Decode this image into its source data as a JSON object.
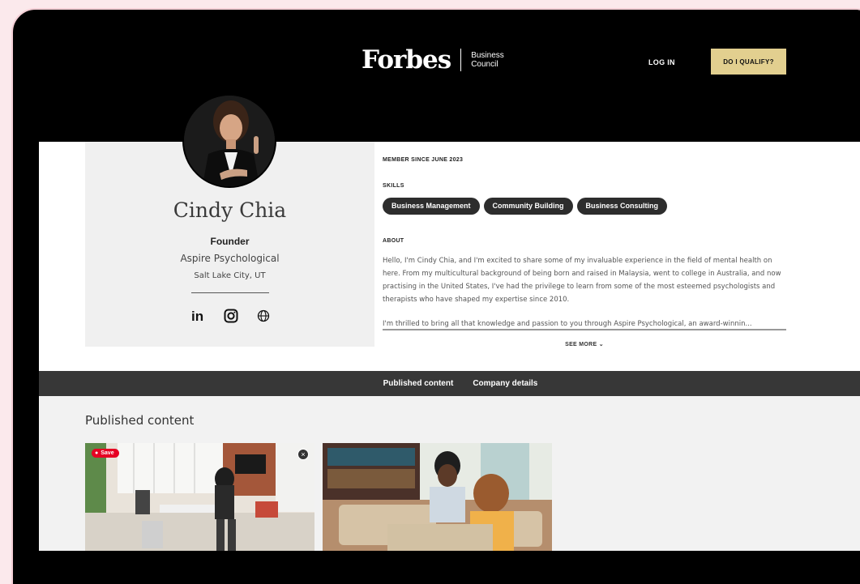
{
  "header": {
    "logo_main": "Forbes",
    "logo_sub_line1": "Business",
    "logo_sub_line2": "Council",
    "login_label": "LOG IN",
    "qualify_label": "DO I QUALIFY?"
  },
  "profile": {
    "name": "Cindy Chia",
    "role": "Founder",
    "company": "Aspire Psychological",
    "location": "Salt Lake City, UT",
    "socials": [
      "linkedin-icon",
      "instagram-icon",
      "globe-icon"
    ],
    "member_since": "MEMBER SINCE JUNE 2023",
    "skills_label": "SKILLS",
    "skills": [
      "Business Management",
      "Community Building",
      "Business Consulting"
    ],
    "about_label": "ABOUT",
    "about_p1": "Hello, I'm Cindy Chia, and I'm excited to share some of my invaluable experience in the field of mental health on here. From my multicultural background of being born and raised in Malaysia, went to college in Australia, and now practising in the United States, I've had the privilege to learn from some of the most esteemed psychologists and therapists who have shaped my expertise since 2010.",
    "about_p2": "I'm thrilled to bring all that knowledge and passion to you through Aspire Psychological, an award-winnin...",
    "see_more": "SEE MORE"
  },
  "tabs": [
    "Published content",
    "Company details"
  ],
  "published": {
    "heading": "Published content",
    "save_label": "Save"
  },
  "colors": {
    "accent_gold": "#e2cf8f",
    "pinterest_red": "#e60023",
    "tabs_bar": "#373737"
  }
}
